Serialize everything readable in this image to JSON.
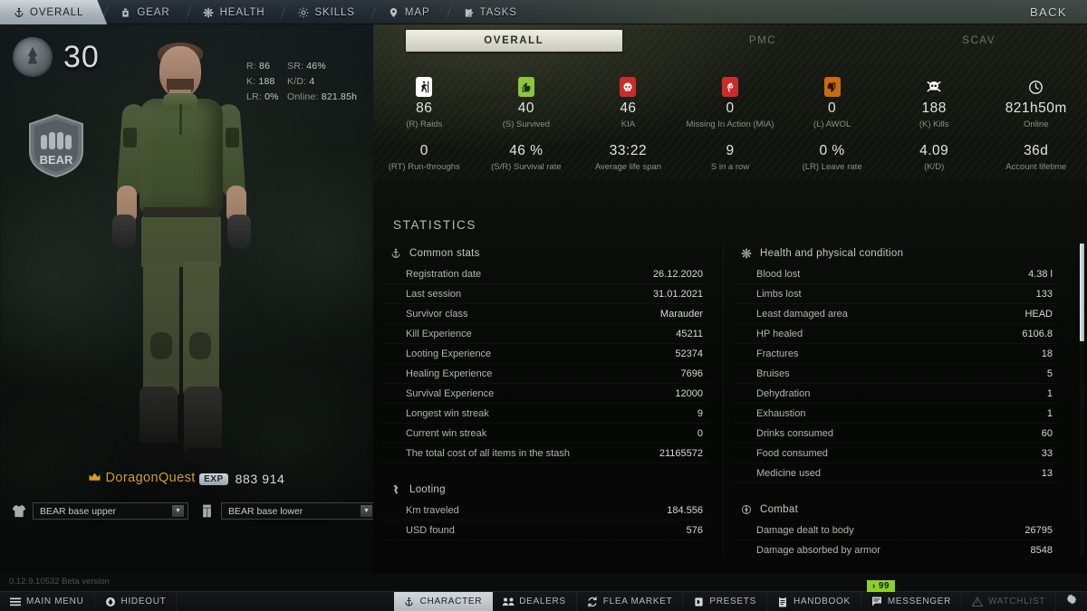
{
  "nav": {
    "tabs": [
      {
        "label": "OVERALL",
        "icon": "anchor-icon",
        "active": true
      },
      {
        "label": "GEAR",
        "icon": "backpack-icon",
        "active": false
      },
      {
        "label": "HEALTH",
        "icon": "asterisk-icon",
        "active": false
      },
      {
        "label": "SKILLS",
        "icon": "sun-icon",
        "active": false
      },
      {
        "label": "MAP",
        "icon": "pin-icon",
        "active": false
      },
      {
        "label": "TASKS",
        "icon": "clipboard-icon",
        "active": false
      }
    ],
    "back_label": "BACK"
  },
  "character": {
    "level": "30",
    "faction": "BEAR",
    "name": "DoragonQuest",
    "name_color": "#d8a020",
    "exp_badge": "EXP",
    "exp_value": "883 914",
    "mini_stats": [
      {
        "label": "R:",
        "value": "86",
        "label2": "SR:",
        "value2": "46%"
      },
      {
        "label": "K:",
        "value": "188",
        "label2": "K/D:",
        "value2": "4"
      },
      {
        "label": "LR:",
        "value": "0%",
        "label2": "Online:",
        "value2": "821.85h"
      }
    ],
    "clothing": [
      {
        "icon": "shirt-icon",
        "value": "BEAR base upper"
      },
      {
        "icon": "pants-icon",
        "value": "BEAR base lower"
      }
    ]
  },
  "mode_tabs": [
    {
      "label": "OVERALL",
      "active": true
    },
    {
      "label": "PMC",
      "active": false
    },
    {
      "label": "SCAV",
      "active": false
    }
  ],
  "summary": {
    "row1": [
      {
        "value": "86",
        "label": "(R) Raids",
        "icon": "runner-exit-icon",
        "color": "#ffffff"
      },
      {
        "value": "40",
        "label": "(S) Survived",
        "icon": "thumbs-up-icon",
        "color": "#8cc63f"
      },
      {
        "value": "46",
        "label": "KIA",
        "icon": "skull-icon",
        "color": "#cc2b2b"
      },
      {
        "value": "0",
        "label": "Missing In Action (MIA)",
        "icon": "mia-icon",
        "color": "#cc2b2b"
      },
      {
        "value": "0",
        "label": "(L) AWOL",
        "icon": "thumbs-down-icon",
        "color": "#c96a12"
      },
      {
        "value": "188",
        "label": "(K) Kills",
        "icon": "skull-crossbones-icon",
        "color": "#ffffff"
      },
      {
        "value": "821h50m",
        "label": "Online",
        "icon": "clock-icon",
        "color": "#ffffff"
      }
    ],
    "row2": [
      {
        "value": "0",
        "label": "(RT) Run-throughs"
      },
      {
        "value": "46 %",
        "label": "(S/R) Survival rate"
      },
      {
        "value": "33:22",
        "label": "Average life span"
      },
      {
        "value": "9",
        "label": "S in a row"
      },
      {
        "value": "0 %",
        "label": "(LR) Leave rate"
      },
      {
        "value": "4.09",
        "label": "(K/D)"
      },
      {
        "value": "36d",
        "label": "Account lifetime"
      }
    ]
  },
  "statistics": {
    "title": "STATISTICS",
    "left_groups": [
      {
        "title": "Common stats",
        "icon": "anchor-icon",
        "rows": [
          {
            "k": "Registration date",
            "v": "26.12.2020"
          },
          {
            "k": "Last session",
            "v": "31.01.2021"
          },
          {
            "k": "Survivor class",
            "v": "Marauder"
          },
          {
            "k": "Kill Experience",
            "v": "45211"
          },
          {
            "k": "Looting Experience",
            "v": "52374"
          },
          {
            "k": "Healing Experience",
            "v": "7696"
          },
          {
            "k": "Survival Experience",
            "v": "12000"
          },
          {
            "k": "Longest win streak",
            "v": "9"
          },
          {
            "k": "Current win streak",
            "v": "0"
          },
          {
            "k": "The total cost of all items in the stash",
            "v": "21165572"
          }
        ]
      },
      {
        "title": "Looting",
        "icon": "loot-icon",
        "rows": [
          {
            "k": "Km traveled",
            "v": "184.556"
          },
          {
            "k": "USD found",
            "v": "576"
          }
        ]
      }
    ],
    "right_groups": [
      {
        "title": "Health and physical condition",
        "icon": "asterisk-icon",
        "rows": [
          {
            "k": "Blood lost",
            "v": "4.38 l"
          },
          {
            "k": "Limbs lost",
            "v": "133"
          },
          {
            "k": "Least damaged area",
            "v": "HEAD"
          },
          {
            "k": "HP healed",
            "v": "6106.8"
          },
          {
            "k": "Fractures",
            "v": "18"
          },
          {
            "k": "Bruises",
            "v": "5"
          },
          {
            "k": "Dehydration",
            "v": "1"
          },
          {
            "k": "Exhaustion",
            "v": "1"
          },
          {
            "k": "Drinks consumed",
            "v": "60"
          },
          {
            "k": "Food consumed",
            "v": "33"
          },
          {
            "k": "Medicine used",
            "v": "13"
          }
        ]
      },
      {
        "title": "Combat",
        "icon": "target-icon",
        "rows": [
          {
            "k": "Damage dealt to body",
            "v": "26795"
          },
          {
            "k": "Damage absorbed by armor",
            "v": "8548"
          }
        ]
      }
    ]
  },
  "footer": {
    "version": "0.12.9.10532 Beta version",
    "left_buttons": [
      {
        "label": "MAIN MENU",
        "icon": "hamburger-icon",
        "active": false
      },
      {
        "label": "HIDEOUT",
        "icon": "hideout-icon",
        "active": false
      }
    ],
    "right_buttons": [
      {
        "label": "CHARACTER",
        "icon": "anchor-icon",
        "active": true,
        "dim": false
      },
      {
        "label": "DEALERS",
        "icon": "people-icon",
        "active": false,
        "dim": false
      },
      {
        "label": "FLEA MARKET",
        "icon": "refresh-icon",
        "active": false,
        "dim": false
      },
      {
        "label": "PRESETS",
        "icon": "presets-icon",
        "active": false,
        "dim": false
      },
      {
        "label": "HANDBOOK",
        "icon": "book-icon",
        "active": false,
        "dim": false
      },
      {
        "label": "MESSENGER",
        "icon": "chat-icon",
        "active": false,
        "dim": false
      },
      {
        "label": "WATCHLIST",
        "icon": "warning-icon",
        "active": false,
        "dim": true
      }
    ],
    "notification_badge": "› 99",
    "badge_color": "#8ccf28",
    "settings_icon": "gear-icon"
  }
}
